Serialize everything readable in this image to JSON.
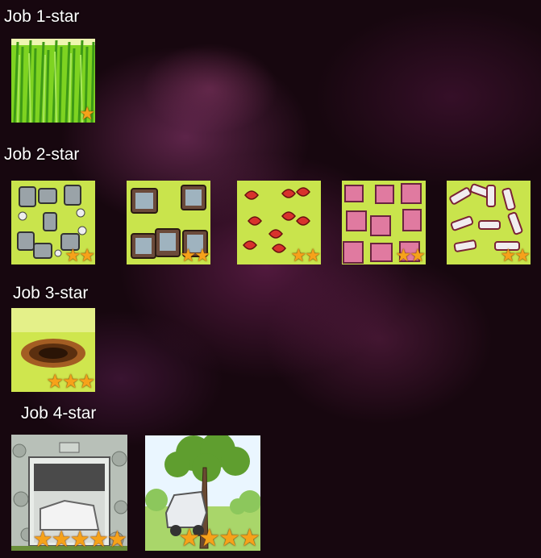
{
  "sections": [
    {
      "title": "Job 1-star",
      "stars": 1,
      "jobs": [
        "grass"
      ]
    },
    {
      "title": "Job 2-star",
      "stars": 2,
      "jobs": [
        "trash-cans",
        "broken-tvs",
        "apple-cores",
        "pink-boxes",
        "bottles"
      ]
    },
    {
      "title": "Job 3-star",
      "stars": 3,
      "jobs": [
        "dirt-hole"
      ]
    },
    {
      "title": "Job 4-star",
      "stars": 4,
      "jobs": [
        "garage",
        "tree-car"
      ]
    }
  ],
  "star_glyph": "★",
  "colors": {
    "star": "#f6a21a",
    "tile_bg": "#c8e64a",
    "title_text": "#ffffff"
  }
}
